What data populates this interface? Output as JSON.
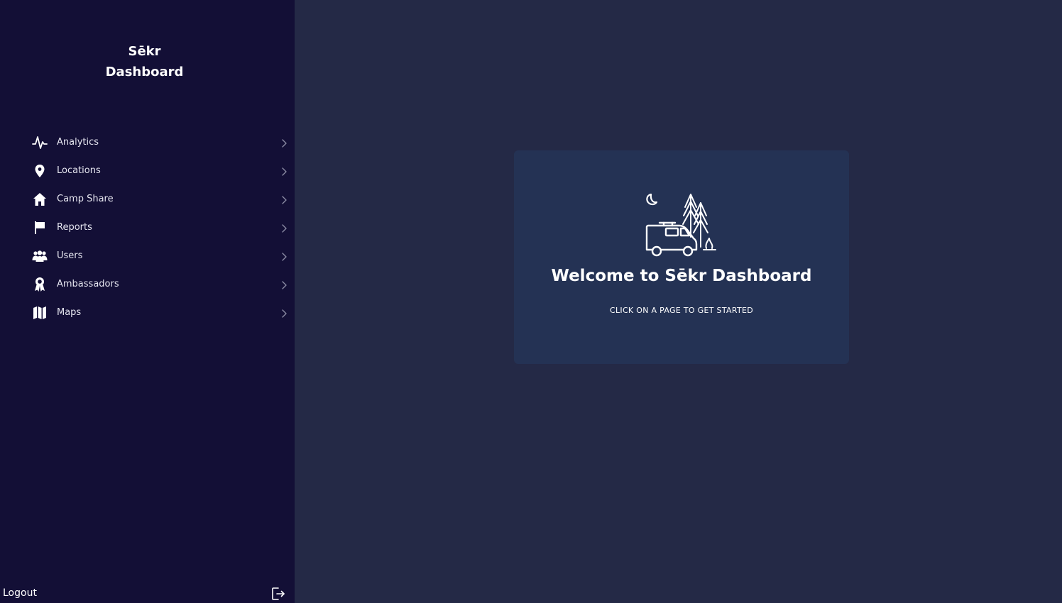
{
  "sidebar": {
    "brand_line1": "Sēkr",
    "brand_line2": "Dashboard",
    "items": [
      {
        "label": "Analytics",
        "icon": "activity-icon"
      },
      {
        "label": "Locations",
        "icon": "map-pin-icon"
      },
      {
        "label": "Camp Share",
        "icon": "home-icon"
      },
      {
        "label": "Reports",
        "icon": "flag-icon"
      },
      {
        "label": "Users",
        "icon": "users-icon"
      },
      {
        "label": "Ambassadors",
        "icon": "award-icon"
      },
      {
        "label": "Maps",
        "icon": "map-icon"
      }
    ],
    "logout_label": "Logout"
  },
  "main": {
    "welcome_title": "Welcome to Sēkr Dashboard",
    "welcome_subtitle": "CLICK ON A PAGE TO GET STARTED"
  },
  "colors": {
    "sidebar_bg": "#130f36",
    "main_bg": "#242946",
    "card_bg": "#243254",
    "text": "#ffffff"
  }
}
